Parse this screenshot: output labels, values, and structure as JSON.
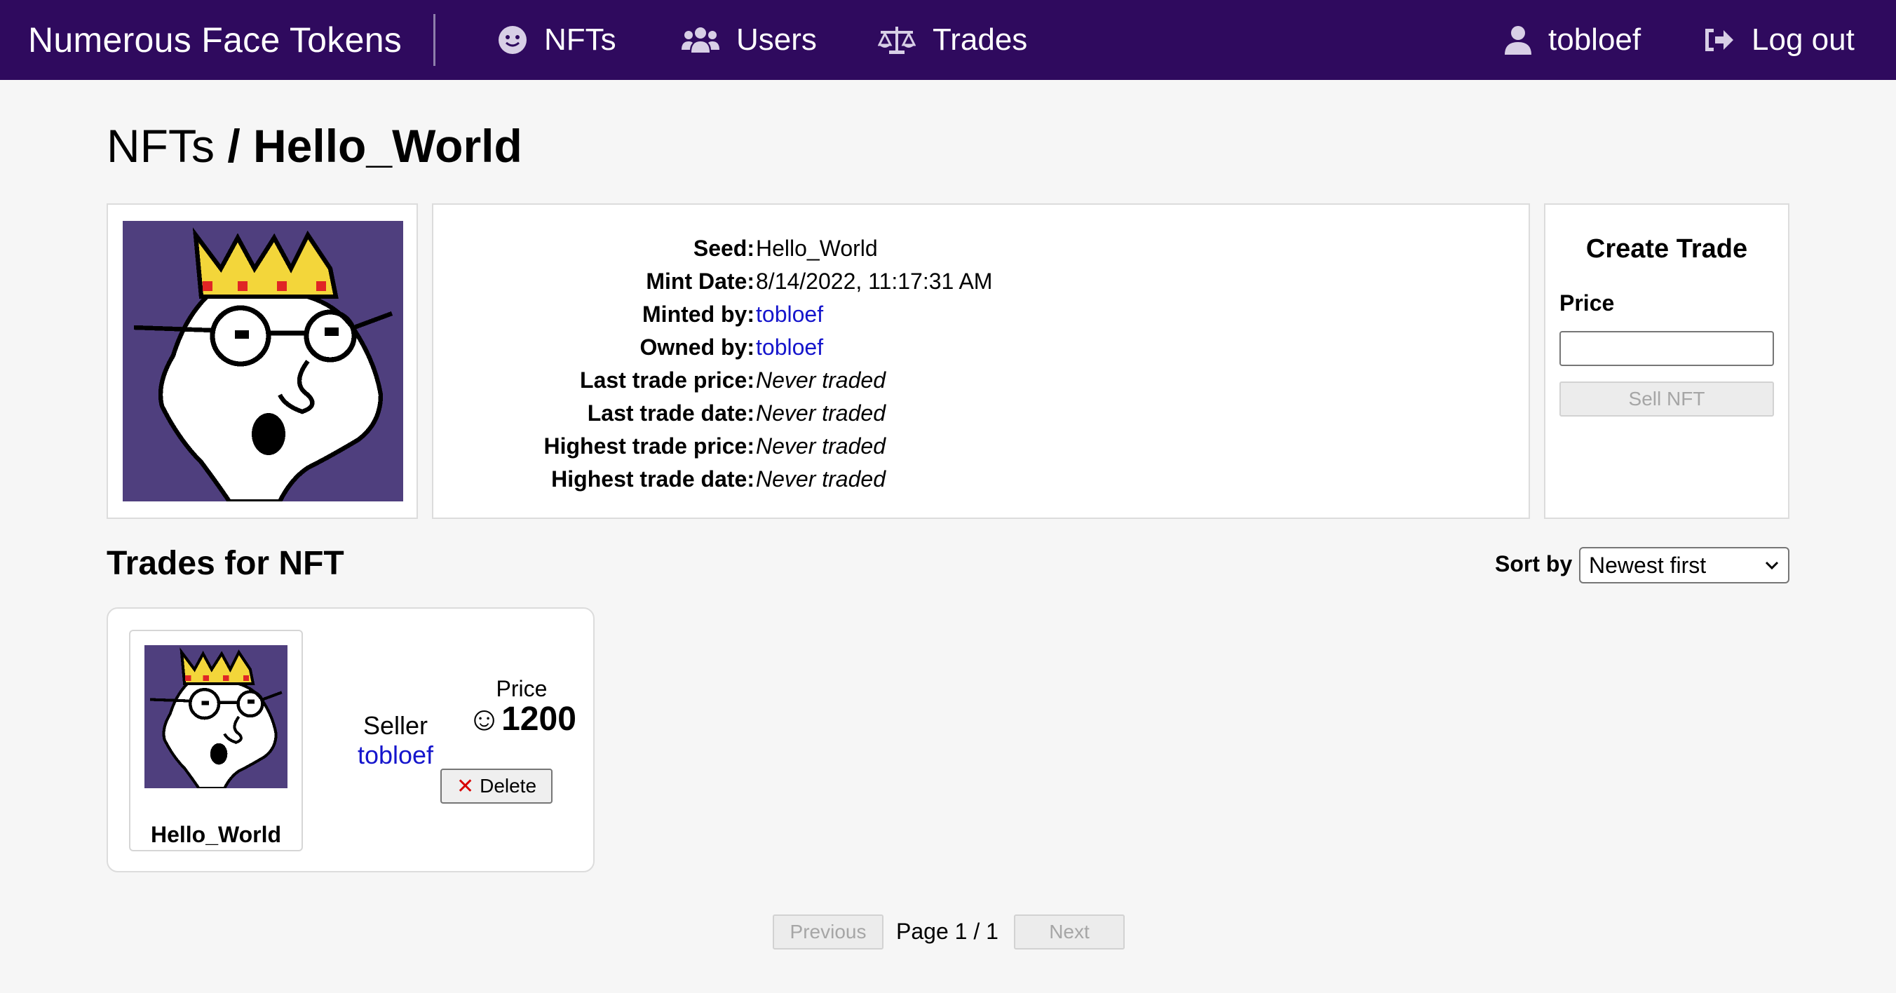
{
  "nav": {
    "brand": "Numerous Face Tokens",
    "nfts": "NFTs",
    "users": "Users",
    "trades": "Trades",
    "user": "tobloef",
    "logout": "Log out"
  },
  "breadcrumb": {
    "parent": "NFTs",
    "sep": " / ",
    "current": "Hello_World"
  },
  "nft": {
    "rows": [
      {
        "label": "Seed:",
        "value": "Hello_World"
      },
      {
        "label": "Mint Date:",
        "value": "8/14/2022, 11:17:31 AM"
      },
      {
        "label": "Minted by:",
        "value": "tobloef"
      },
      {
        "label": "Owned by:",
        "value": "tobloef"
      },
      {
        "label": "Last trade price:",
        "value": "Never traded"
      },
      {
        "label": "Last trade date:",
        "value": "Never traded"
      },
      {
        "label": "Highest trade price:",
        "value": "Never traded"
      },
      {
        "label": "Highest trade date:",
        "value": "Never traded"
      }
    ]
  },
  "create_trade": {
    "title": "Create Trade",
    "price_label": "Price",
    "price_value": "",
    "sell_button": "Sell NFT"
  },
  "trades": {
    "title": "Trades for NFT",
    "sort_label": "Sort by",
    "sort_value": "Newest first",
    "items": [
      {
        "nft_name": "Hello_World",
        "seller_label": "Seller",
        "seller": "tobloef",
        "price_label": "Price",
        "price": "☺1200",
        "delete_label": "Delete"
      }
    ]
  },
  "pagination": {
    "previous": "Previous",
    "page": "Page 1 / 1",
    "next": "Next"
  },
  "colors": {
    "topbar": "#2f0a5e",
    "link": "#1515cc",
    "nft_background": "#4f3f7e",
    "crown": "#f3d63a",
    "jewel": "#e02525"
  }
}
